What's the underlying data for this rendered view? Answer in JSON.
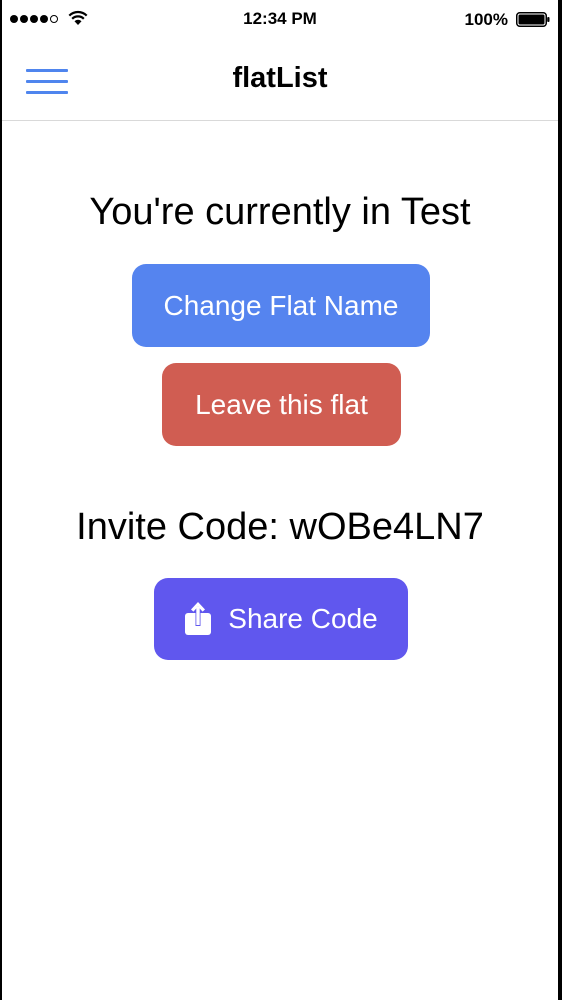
{
  "status_bar": {
    "time": "12:34 PM",
    "battery_percent": "100%",
    "signal_icon": "signal-dots-icon",
    "wifi_icon": "wifi-icon",
    "battery_icon": "battery-full-icon"
  },
  "header": {
    "title": "flatList",
    "menu_icon": "hamburger-menu-icon"
  },
  "main": {
    "current_flat_text": "You're currently in Test",
    "change_name_label": "Change Flat Name",
    "leave_label": "Leave this flat",
    "invite_code_text": "Invite Code: wOBe4LN7",
    "share_label": "Share Code",
    "share_icon": "share-icon"
  },
  "colors": {
    "accent_blue": "#5584ef",
    "menu_blue": "#4f85ee",
    "danger_red": "#d05d52",
    "share_purple": "#6057ee"
  }
}
